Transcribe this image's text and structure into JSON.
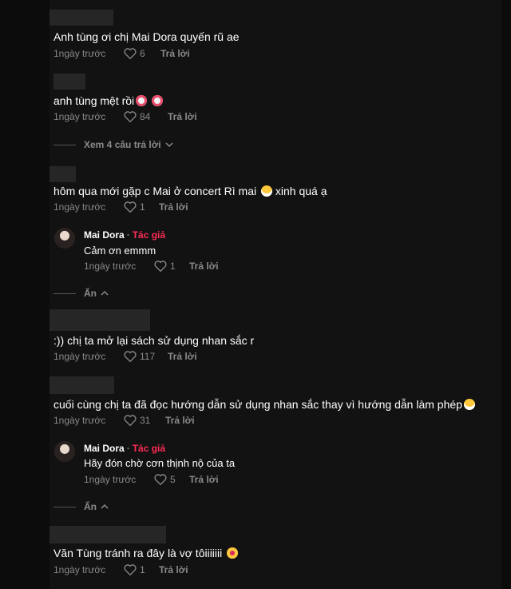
{
  "comments": [
    {
      "text": "Anh tùng ơi chị Mai Dora quyến rũ ae",
      "time": "1ngày trước",
      "likes": "6",
      "reply": "Trả lời"
    },
    {
      "text": "anh tùng mệt rồi",
      "time": "1ngày trước",
      "likes": "84",
      "reply": "Trả lời",
      "view_replies": "Xem 4 câu trả lời"
    },
    {
      "text": "hôm qua mới gặp c Mai ở concert Rì mai",
      "text_after": "xinh quá ạ",
      "time": "1ngày trước",
      "likes": "1",
      "reply": "Trả lời"
    },
    {
      "text": ":)) chị ta mở lại sách sử dụng nhan sắc r",
      "time": "1ngày trước",
      "likes": "117",
      "reply": "Trả lời"
    },
    {
      "text": "cuối cùng chị ta đã đọc hướng dẫn sử dụng nhan sắc thay vì hướng dẫn làm phép",
      "time": "1ngày trước",
      "likes": "31",
      "reply": "Trả lời"
    },
    {
      "text": "Văn Tùng tránh ra đây là vợ tôiiiiiii",
      "time": "1ngày trước",
      "likes": "1",
      "reply": "Trả lời"
    }
  ],
  "replies": [
    {
      "author": "Mai Dora",
      "separator": "·",
      "badge": "Tác giả",
      "text": "Cảm ơn emmm",
      "time": "1ngày trước",
      "likes": "1",
      "reply": "Trả lời",
      "hide": "Ẩn"
    },
    {
      "author": "Mai Dora",
      "separator": "·",
      "badge": "Tác giả",
      "text": "Hãy đón chờ cơn thịnh nộ của ta",
      "time": "1ngày trước",
      "likes": "5",
      "reply": "Trả lời",
      "hide": "Ẩn"
    }
  ],
  "colors": {
    "background": "#121212",
    "muted": "#8a8a8a",
    "author_badge": "#fe2c55",
    "redaction": "#262626"
  },
  "icons": [
    "heart-icon",
    "chevron-down-icon",
    "chevron-up-icon",
    "clown-emoji-icon",
    "grin-emoji-icon",
    "astonished-emoji-icon",
    "avatar"
  ]
}
